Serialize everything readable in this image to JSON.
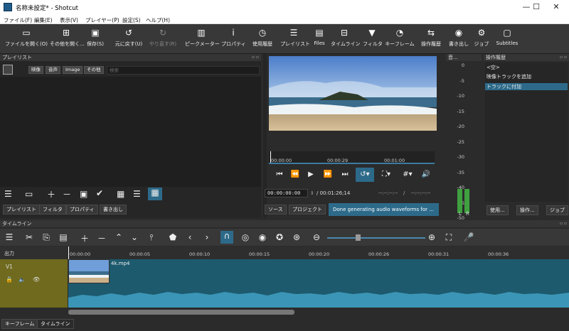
{
  "window": {
    "title": "名称未設定* - Shotcut",
    "controls": [
      "—",
      "☐",
      "✕"
    ]
  },
  "menu": [
    "ファイル(F)",
    "編集(E)",
    "表示(V)",
    "プレイヤー(P)",
    "設定(S)",
    "ヘルプ(H)"
  ],
  "toolbar": [
    {
      "label": "ファイルを開く(O)",
      "icon": "folder-icon"
    },
    {
      "label": "その他を開く...",
      "icon": "open-other-icon"
    },
    {
      "label": "保存(S)",
      "icon": "save-icon"
    },
    {
      "label": "元に戻す(U)",
      "icon": "undo-icon"
    },
    {
      "label": "やり直す(R)",
      "icon": "redo-icon",
      "disabled": true
    },
    {
      "label": "ピークメーター",
      "icon": "peak-meter-icon"
    },
    {
      "label": "プロパティ",
      "icon": "info-icon"
    },
    {
      "label": "使用履歴",
      "icon": "clock-icon"
    },
    {
      "label": "プレイリスト",
      "icon": "list-icon"
    },
    {
      "label": "Files",
      "icon": "files-icon"
    },
    {
      "label": "タイムライン",
      "icon": "timeline-icon"
    },
    {
      "label": "フィルタ",
      "icon": "filter-icon"
    },
    {
      "label": "キーフレーム",
      "icon": "stopwatch-icon"
    },
    {
      "label": "操作履歴",
      "icon": "history-icon"
    },
    {
      "label": "書き出し",
      "icon": "export-icon"
    },
    {
      "label": "ジョブ",
      "icon": "gear-icon"
    },
    {
      "label": "Subtitles",
      "icon": "subtitles-icon"
    }
  ],
  "playlist": {
    "title": "プレイリスト",
    "tabs": [
      "映像",
      "音声",
      "Image",
      "その他"
    ],
    "search_placeholder": "検索",
    "buttons": [
      "プレイリスト",
      "フィルタ",
      "プロパティ",
      "書き出し"
    ]
  },
  "viewer": {
    "ruler_ticks": [
      "00:00:00",
      "00:00:29",
      "00:01:00"
    ],
    "timecode": "00:00:00:00",
    "duration": "/ 00:01:26;14",
    "in_point": "--:--:--:--",
    "out_point": "--:--:--:--",
    "source_tab": "ソース",
    "project_tab": "プロジェクト",
    "status": "Done generating audio waveforms for ..."
  },
  "meter": {
    "title": "音...",
    "scale": [
      "0",
      "-5",
      "-10",
      "-15",
      "-20",
      "-25",
      "-30",
      "-35",
      "-40",
      "-45",
      "-50"
    ],
    "channels": [
      "L",
      "R"
    ],
    "level_l": 0.18,
    "level_r": 0.2
  },
  "history": {
    "title": "操作履歴",
    "items": [
      "<空>",
      "映像トラックを追加",
      "トラックに付加"
    ],
    "selected": 2,
    "buttons": [
      "使用...",
      "操作...",
      "ジョブ"
    ]
  },
  "timeline": {
    "title": "タイムライン",
    "output_label": "出力",
    "track_name": "V1",
    "clip_name": "4k.mp4",
    "ruler": [
      "00:00:00",
      "00:00:05",
      "00:00:10",
      "00:00:15",
      "00:00:20",
      "00:00:26",
      "00:00:31",
      "00:00:36"
    ],
    "bottom_tabs": [
      "キーフレーム",
      "タイムライン"
    ]
  },
  "colors": {
    "accent": "#2d6a8a",
    "track": "#1d5a6e",
    "track_header": "#6f6a1e"
  }
}
